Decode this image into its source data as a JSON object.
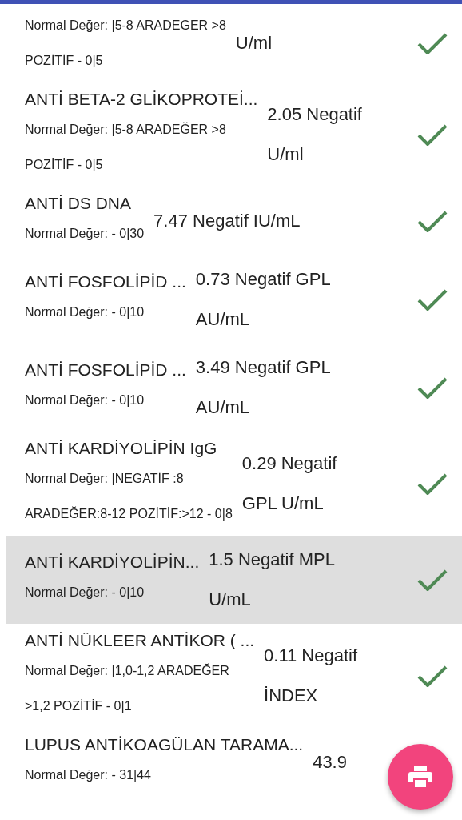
{
  "results": [
    {
      "normal_lines": [
        "Normal Değer: |5-8 ARADEGER >8",
        "POZİTİF - 0|5"
      ],
      "value_lines": [
        "U/ml"
      ],
      "ok": true,
      "selected": false
    },
    {
      "name": "ANTİ BETA-2 GLİKOPROTEİ...",
      "normal_lines": [
        "Normal Değer: |5-8 ARADEĞER >8",
        "POZİTİF - 0|5"
      ],
      "value_lines": [
        "2.05 Negatif",
        "U/ml"
      ],
      "ok": true,
      "selected": false
    },
    {
      "name": "ANTİ DS DNA",
      "normal_lines": [
        "Normal Değer: - 0|30"
      ],
      "value_lines": [
        "7.47 Negatif IU/mL"
      ],
      "ok": true,
      "selected": false
    },
    {
      "name": "ANTİ FOSFOLİPİD ...",
      "normal_lines": [
        "Normal Değer: - 0|10"
      ],
      "value_lines": [
        "0.73 Negatif GPL",
        "AU/mL"
      ],
      "ok": true,
      "selected": false
    },
    {
      "name": "ANTİ FOSFOLİPİD ...",
      "normal_lines": [
        "Normal Değer: - 0|10"
      ],
      "value_lines": [
        "3.49 Negatif GPL",
        "AU/mL"
      ],
      "ok": true,
      "selected": false
    },
    {
      "name": "ANTİ KARDİYOLİPİN IgG",
      "normal_lines": [
        "Normal Değer: |NEGATİF :8",
        "ARADEĞER:8-12 POZİTİF:>12 - 0|8"
      ],
      "value_lines": [
        "0.29 Negatif",
        "GPL U/mL"
      ],
      "ok": true,
      "selected": false
    },
    {
      "name": "ANTİ KARDİYOLİPİN...",
      "normal_lines": [
        "Normal Değer: - 0|10"
      ],
      "value_lines": [
        "1.5 Negatif MPL",
        "U/mL"
      ],
      "ok": true,
      "selected": true
    },
    {
      "name": "ANTİ NÜKLEER ANTİKOR ( ...",
      "normal_lines": [
        "Normal Değer: |1,0-1,2 ARADEĞER",
        ">1,2 POZİTİF - 0|1"
      ],
      "value_lines": [
        "0.11 Negatif",
        "İNDEX"
      ],
      "ok": true,
      "selected": false
    },
    {
      "name": "LUPUS ANTİKOAGÜLAN TARAMA...",
      "normal_lines": [
        "Normal Değer: - 31|44"
      ],
      "value_lines": [
        "43.9"
      ],
      "selected": false
    }
  ]
}
